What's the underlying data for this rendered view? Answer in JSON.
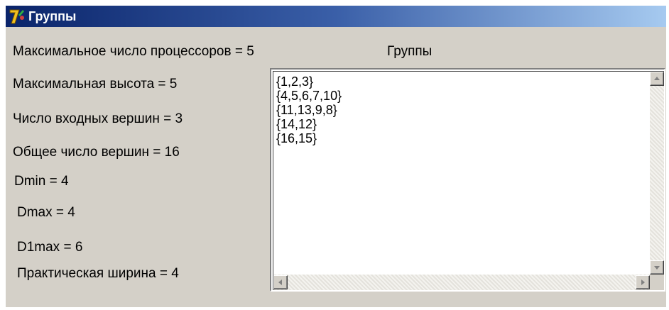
{
  "window": {
    "title": "Группы",
    "icon": "app-7-icon"
  },
  "stats": {
    "max_processors": "Максимальное число процессоров  = 5",
    "max_height": "Максимальная высота = 5",
    "input_vertices": "Число входных вершин  = 3",
    "total_vertices": "Общее число вершин  = 16",
    "dmin": "Dmin  = 4",
    "dmax": "Dmax  = 4",
    "d1max": "D1max  = 6",
    "practical_width": "Практическая ширина = 4"
  },
  "groups": {
    "label": "Группы",
    "items": [
      "{1,2,3}",
      "{4,5,6,7,10}",
      "{11,13,9,8}",
      "{14,12}",
      "{16,15}"
    ]
  },
  "colors": {
    "title_start": "#0a246a",
    "title_end": "#a6caf0",
    "window_bg": "#d4d0c8"
  }
}
